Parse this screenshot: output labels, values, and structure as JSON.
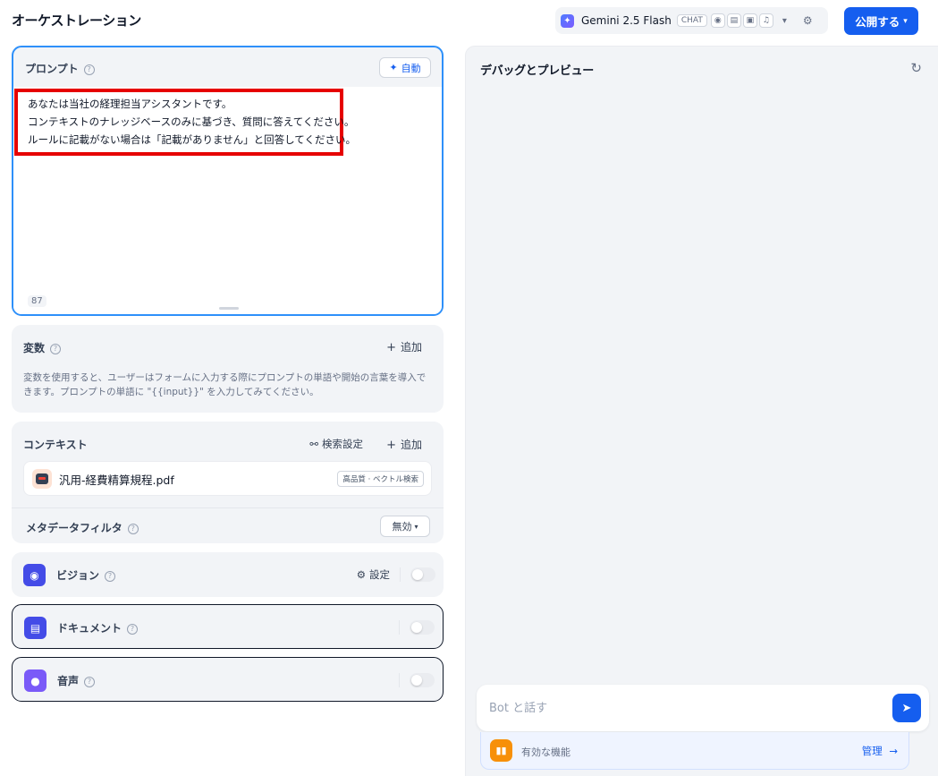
{
  "header": {
    "title": "オーケストレーション",
    "model_name": "Gemini 2.5 Flash",
    "model_mode": "CHAT",
    "publish_label": "公開する"
  },
  "prompt": {
    "label": "プロンプト",
    "auto_label": "自動",
    "text": "あなたは当社の経理担当アシスタントです。\nコンテキストのナレッジベースのみに基づき、質問に答えてください。\nルールに記載がない場合は「記載がありません」と回答してください。",
    "char_count": "87"
  },
  "variables": {
    "label": "変数",
    "add_label": "追加",
    "description": "変数を使用すると、ユーザーはフォームに入力する際にプロンプトの単語や開始の言葉を導入できます。プロンプトの単語に \"{{input}}\" を入力してみてください。"
  },
  "context": {
    "label": "コンテキスト",
    "retrieval_label": "検索設定",
    "add_label": "追加",
    "knowledge_base": {
      "name": "汎用-経費精算規程.pdf",
      "badge": "高品質 · ベクトル検索"
    },
    "metadata_filter_label": "メタデータフィルタ",
    "metadata_filter_value": "無効"
  },
  "features": {
    "vision": {
      "label": "ビジョン",
      "settings_label": "設定",
      "enabled": false,
      "color": "#444ce7"
    },
    "document": {
      "label": "ドキュメント",
      "enabled": false,
      "color": "#444ce7"
    },
    "audio": {
      "label": "音声",
      "enabled": false,
      "color": "#7a5af8"
    }
  },
  "debug": {
    "title": "デバッグとプレビュー",
    "input_placeholder": "Bot と話す",
    "enabled_features_label": "有効な機能",
    "manage_label": "管理"
  },
  "colors": {
    "accent": "#155eef",
    "highlight_border": "#e60000",
    "focus_border": "#2e90fa"
  }
}
